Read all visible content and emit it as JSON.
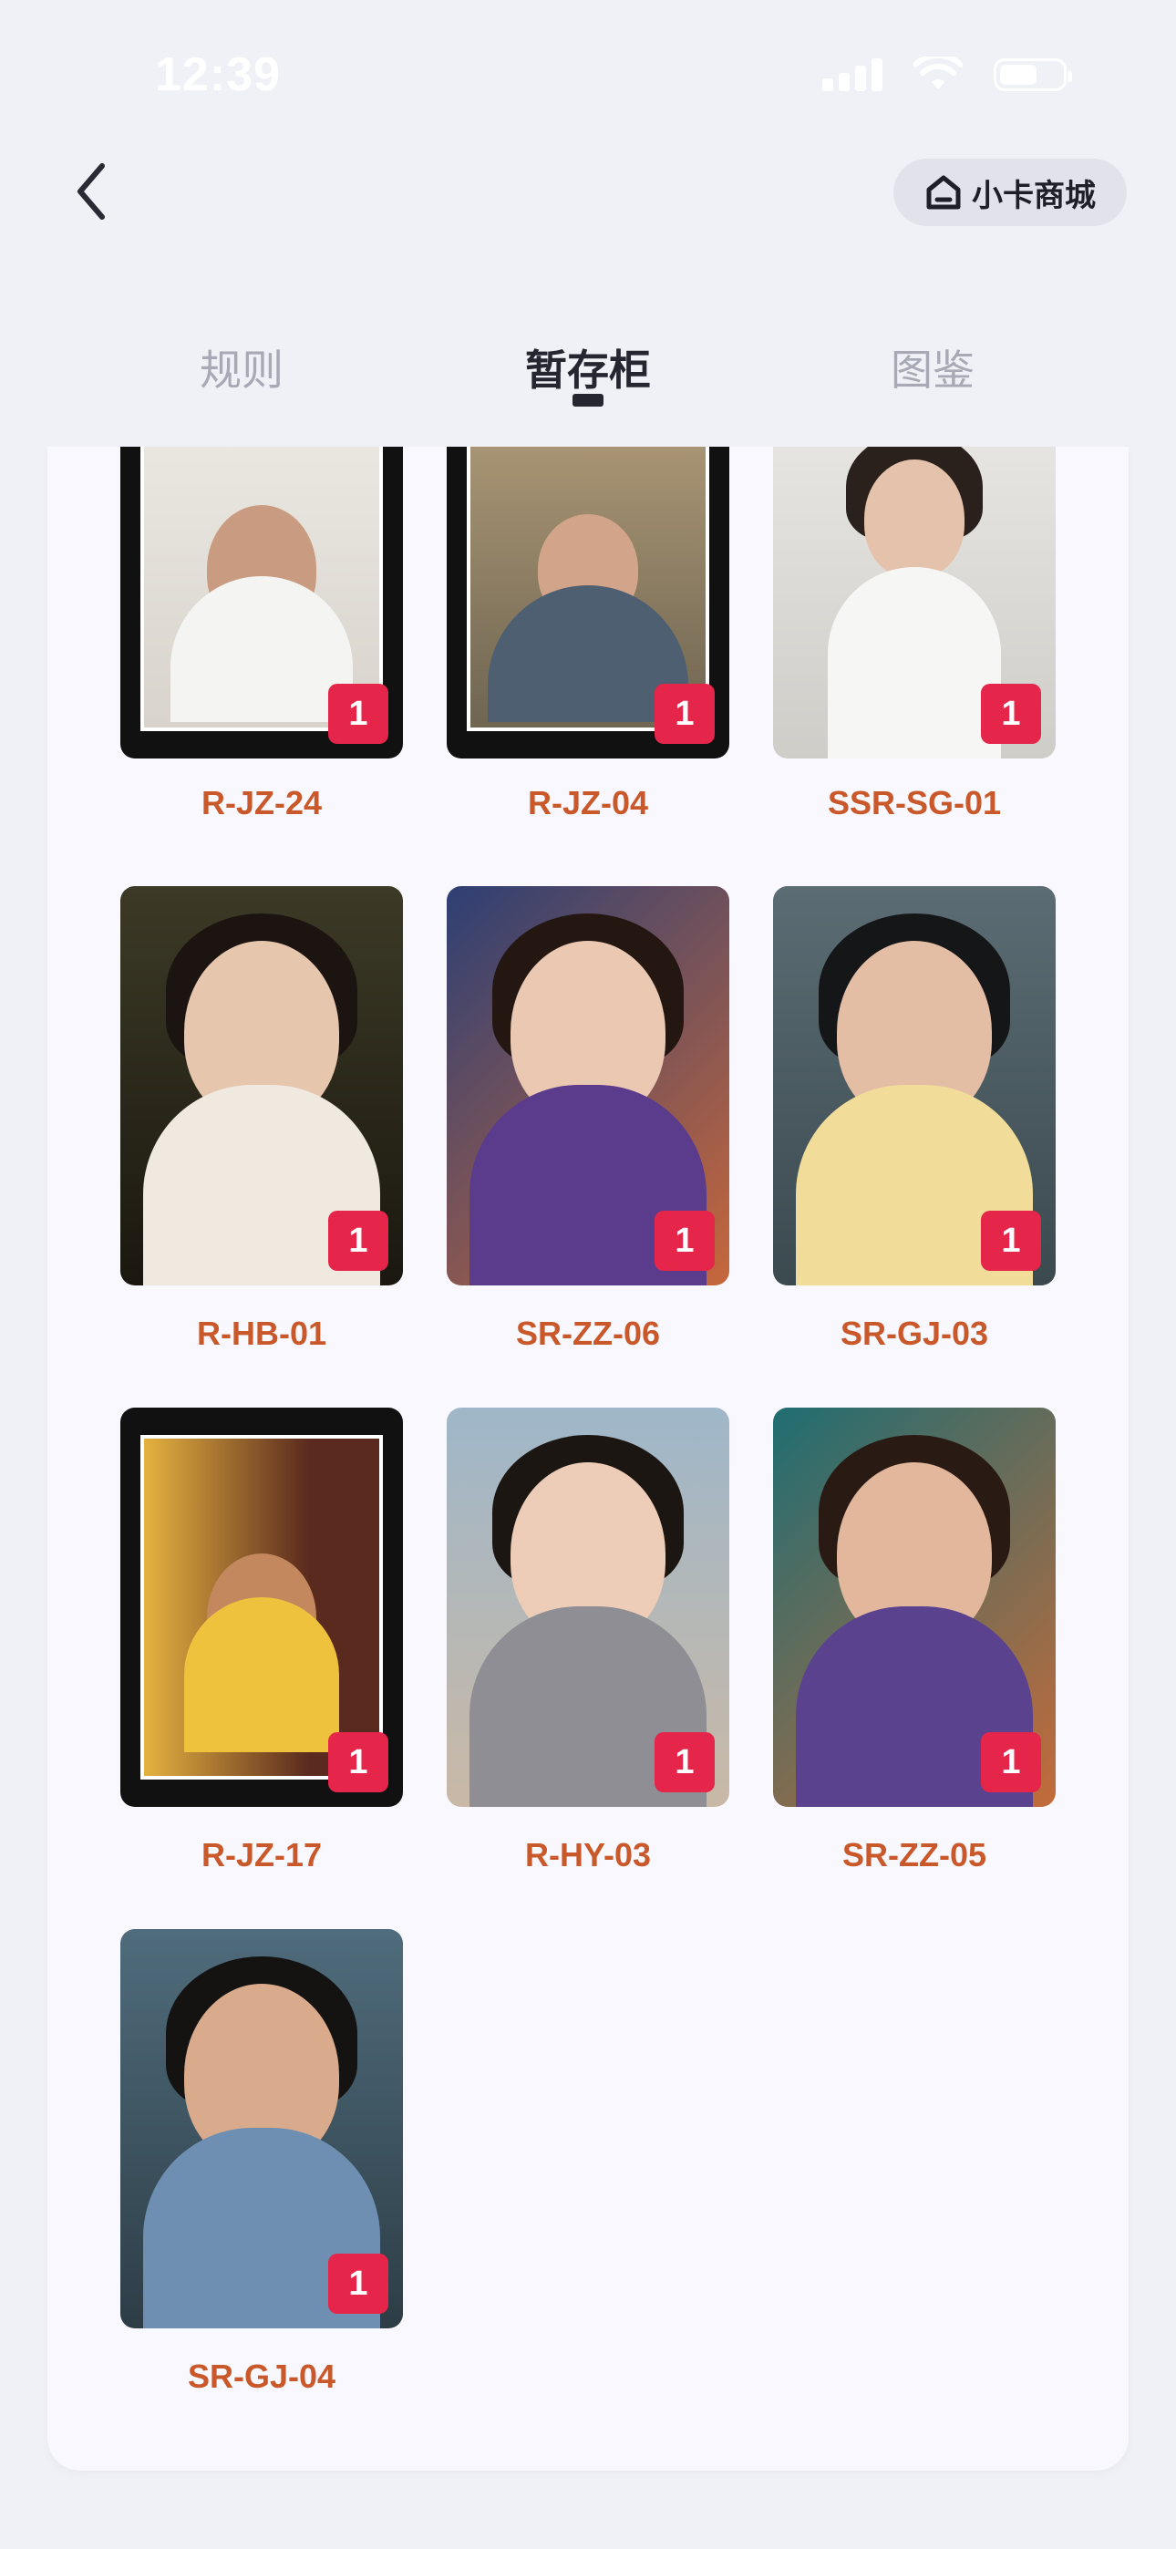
{
  "status_bar": {
    "time": "12:39"
  },
  "header": {
    "shop_label": "小卡商城"
  },
  "tabs": [
    {
      "label": "规则"
    },
    {
      "label": "暂存柜",
      "active": true
    },
    {
      "label": "图鉴"
    }
  ],
  "cards": [
    {
      "code": "R-JZ-24",
      "count": "1"
    },
    {
      "code": "R-JZ-04",
      "count": "1"
    },
    {
      "code": "SSR-SG-01",
      "count": "1"
    },
    {
      "code": "R-HB-01",
      "count": "1"
    },
    {
      "code": "SR-ZZ-06",
      "count": "1"
    },
    {
      "code": "SR-GJ-03",
      "count": "1"
    },
    {
      "code": "R-JZ-17",
      "count": "1"
    },
    {
      "code": "R-HY-03",
      "count": "1"
    },
    {
      "code": "SR-ZZ-05",
      "count": "1"
    },
    {
      "code": "SR-GJ-04",
      "count": "1"
    }
  ],
  "colors": {
    "accent_code": "#c9582a",
    "badge": "#e5254a",
    "tab_active": "#262631",
    "tab_inactive": "#a7a9b4"
  }
}
